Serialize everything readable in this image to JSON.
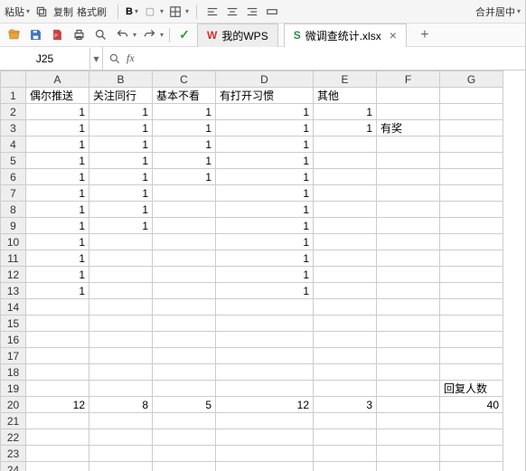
{
  "menu": {
    "paste": "粘贴",
    "copy": "复制",
    "format_brush": "格式刷",
    "merge_center": "合并居中"
  },
  "tabs": [
    {
      "label": "我的WPS",
      "wps_logo": "W"
    },
    {
      "label": "微调查统计.xlsx",
      "sheet_logo": "S"
    }
  ],
  "namebox": "J25",
  "formula": "",
  "chart_data": {
    "type": "table",
    "columns": [
      "A",
      "B",
      "C",
      "D",
      "E",
      "F",
      "G"
    ],
    "headers_row": {
      "A": "偶尔推送",
      "B": "关注同行",
      "C": "基本不看",
      "D": "有打开习惯",
      "E": "其他",
      "F": "",
      "G": ""
    },
    "rows": [
      {
        "A": "1",
        "B": "1",
        "C": "1",
        "D": "1",
        "E": "1",
        "F": "",
        "G": ""
      },
      {
        "A": "1",
        "B": "1",
        "C": "1",
        "D": "1",
        "E": "1",
        "F": "有奖",
        "G": ""
      },
      {
        "A": "1",
        "B": "1",
        "C": "1",
        "D": "1",
        "E": "",
        "F": "",
        "G": ""
      },
      {
        "A": "1",
        "B": "1",
        "C": "1",
        "D": "1",
        "E": "",
        "F": "",
        "G": ""
      },
      {
        "A": "1",
        "B": "1",
        "C": "1",
        "D": "1",
        "E": "",
        "F": "",
        "G": ""
      },
      {
        "A": "1",
        "B": "1",
        "C": "",
        "D": "1",
        "E": "",
        "F": "",
        "G": ""
      },
      {
        "A": "1",
        "B": "1",
        "C": "",
        "D": "1",
        "E": "",
        "F": "",
        "G": ""
      },
      {
        "A": "1",
        "B": "1",
        "C": "",
        "D": "1",
        "E": "",
        "F": "",
        "G": ""
      },
      {
        "A": "1",
        "B": "",
        "C": "",
        "D": "1",
        "E": "",
        "F": "",
        "G": ""
      },
      {
        "A": "1",
        "B": "",
        "C": "",
        "D": "1",
        "E": "",
        "F": "",
        "G": ""
      },
      {
        "A": "1",
        "B": "",
        "C": "",
        "D": "1",
        "E": "",
        "F": "",
        "G": ""
      },
      {
        "A": "1",
        "B": "",
        "C": "",
        "D": "1",
        "E": "",
        "F": "",
        "G": ""
      },
      {
        "A": "",
        "B": "",
        "C": "",
        "D": "",
        "E": "",
        "F": "",
        "G": ""
      },
      {
        "A": "",
        "B": "",
        "C": "",
        "D": "",
        "E": "",
        "F": "",
        "G": ""
      },
      {
        "A": "",
        "B": "",
        "C": "",
        "D": "",
        "E": "",
        "F": "",
        "G": ""
      },
      {
        "A": "",
        "B": "",
        "C": "",
        "D": "",
        "E": "",
        "F": "",
        "G": ""
      },
      {
        "A": "",
        "B": "",
        "C": "",
        "D": "",
        "E": "",
        "F": "",
        "G": ""
      },
      {
        "A": "",
        "B": "",
        "C": "",
        "D": "",
        "E": "",
        "F": "",
        "G": "回复人数"
      },
      {
        "A": "12",
        "B": "8",
        "C": "5",
        "D": "12",
        "E": "3",
        "F": "",
        "G": "40"
      },
      {
        "A": "",
        "B": "",
        "C": "",
        "D": "",
        "E": "",
        "F": "",
        "G": ""
      },
      {
        "A": "",
        "B": "",
        "C": "",
        "D": "",
        "E": "",
        "F": "",
        "G": ""
      },
      {
        "A": "",
        "B": "",
        "C": "",
        "D": "",
        "E": "",
        "F": "",
        "G": ""
      },
      {
        "A": "",
        "B": "",
        "C": "",
        "D": "",
        "E": "",
        "F": "",
        "G": ""
      }
    ],
    "numeric_cols": [
      "A",
      "B",
      "C",
      "D",
      "E",
      "G"
    ]
  }
}
